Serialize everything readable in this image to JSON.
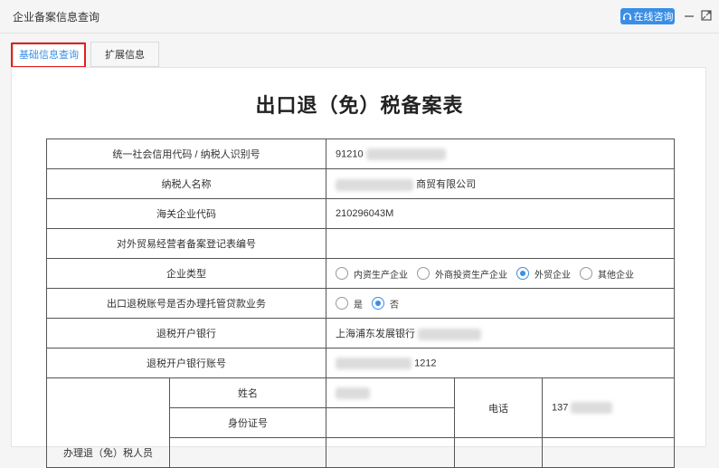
{
  "window": {
    "title": "企业备案信息查询",
    "online_button": "在线咨询"
  },
  "tabs": [
    {
      "label": "基础信息查询",
      "active": true
    },
    {
      "label": "扩展信息",
      "active": false
    }
  ],
  "form": {
    "title": "出口退（免）税备案表",
    "rows": {
      "credit_code": {
        "label": "统一社会信用代码 / 纳税人识别号",
        "value": "91210"
      },
      "taxpayer_name": {
        "label": "纳税人名称",
        "value": "商贸有限公司"
      },
      "customs_code": {
        "label": "海关企业代码",
        "value": "210296043M"
      },
      "foreign_trade_no": {
        "label": "对外贸易经营者备案登记表编号",
        "value": ""
      },
      "enterprise_type": {
        "label": "企业类型",
        "options": [
          "内资生产企业",
          "外商投资生产企业",
          "外贸企业",
          "其他企业"
        ],
        "selected": "外贸企业"
      },
      "trust_loan": {
        "label": "出口退税账号是否办理托管贷款业务",
        "options": [
          "是",
          "否"
        ],
        "selected": "否"
      },
      "bank": {
        "label": "退税开户银行",
        "value": "上海浦东发展银行"
      },
      "bank_account": {
        "label": "退税开户银行账号",
        "value": "1212"
      }
    },
    "handler": {
      "group_label": "办理退（免）税人员",
      "name_label": "姓名",
      "id_label": "身份证号",
      "phone_label": "电话",
      "phone_value": "137"
    }
  },
  "colors": {
    "accent": "#3a8ee6",
    "highlight": "#e02020"
  }
}
